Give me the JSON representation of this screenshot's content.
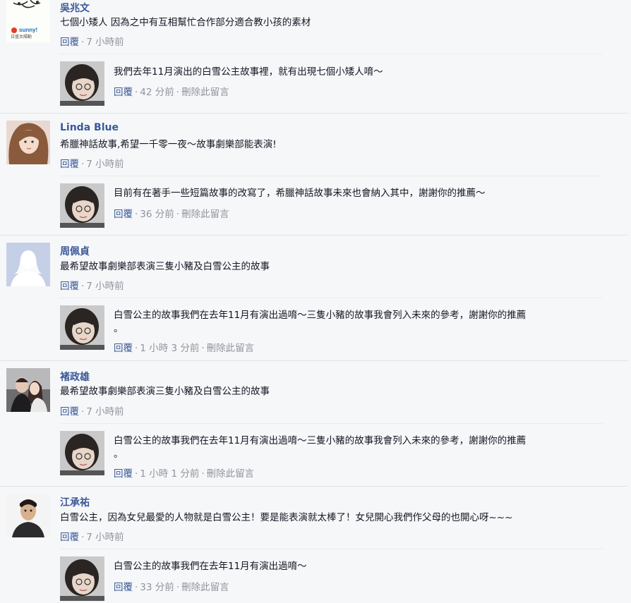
{
  "ui": {
    "reply_label": "回覆",
    "delete_label": "刪除此留言",
    "dot": "·"
  },
  "comments": [
    {
      "name": "吳兆文",
      "text": "七個小矮人 因為之中有互相幫忙合作部分適合教小孩的素材",
      "time": "7 小時前",
      "avatar_text": "sunny! 日盛大陽動",
      "reply": {
        "text": "我們去年11月演出的白雪公主故事裡，就有出現七個小矮人唷～",
        "time": "42 分前"
      }
    },
    {
      "name": "Linda Blue",
      "text": "希臘神話故事,希望一千零一夜～故事劇樂部能表演!",
      "time": "7 小時前",
      "reply": {
        "text": "目前有在著手一些短篇故事的改寫了，希臘神話故事未來也會納入其中，謝謝你的推薦～",
        "time": "36 分前"
      }
    },
    {
      "name": "周佩貞",
      "text": "最希望故事劇樂部表演三隻小豬及白雪公主的故事",
      "time": "7 小時前",
      "reply": {
        "text": "白雪公主的故事我們在去年11月有演出過唷～三隻小豬的故事我會列入未來的參考，謝謝你的推薦",
        "text2": "。",
        "time": "1 小時 3 分前"
      }
    },
    {
      "name": "褚政雄",
      "text": "最希望故事劇樂部表演三隻小豬及白雪公主的故事",
      "time": "7 小時前",
      "reply": {
        "text": "白雪公主的故事我們在去年11月有演出過唷～三隻小豬的故事我會列入未來的參考，謝謝你的推薦",
        "text2": "。",
        "time": "1 小時 1 分前"
      }
    },
    {
      "name": "江承祐",
      "text": "白雪公主，因為女兒最愛的人物就是白雪公主！要是能表演就太棒了！女兒開心我們作父母的也開心呀~~~",
      "time": "7 小時前",
      "reply": {
        "text": "白雪公主的故事我們在去年11月有演出過唷～",
        "time": "33 分前"
      }
    }
  ]
}
